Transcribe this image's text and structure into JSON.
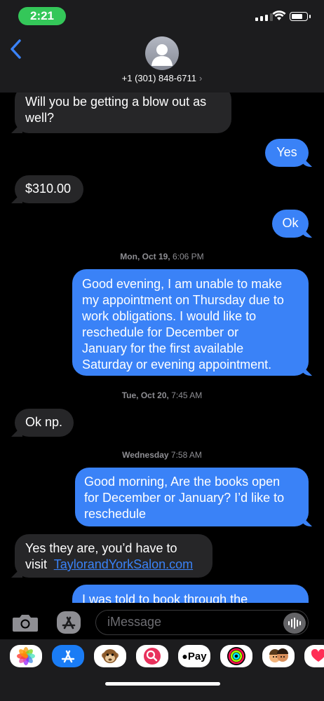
{
  "status": {
    "time": "2:21"
  },
  "header": {
    "back_label": "‹",
    "contact_number": "+1 (301) 848-6711",
    "contact_chevron": "›"
  },
  "messages": [
    {
      "dir": "in",
      "text_lines": [
        "Will you be getting a blow out as",
        "well?"
      ]
    },
    {
      "dir": "out",
      "text": "Yes"
    },
    {
      "dir": "in",
      "text": "$310.00"
    },
    {
      "dir": "out",
      "text": "Ok"
    },
    {
      "type": "timestamp",
      "day": "Mon, Oct 19,",
      "time": "6:06 PM"
    },
    {
      "dir": "out",
      "text_lines": [
        "Good evening, I am unable to make",
        "my appointment on Thursday due to",
        "work obligations. I would like to",
        "reschedule for December or",
        "January for the first available",
        "Saturday or evening appointment."
      ]
    },
    {
      "type": "timestamp",
      "day": "Tue, Oct 20,",
      "time": "7:45 AM"
    },
    {
      "dir": "in",
      "text": "Ok np."
    },
    {
      "type": "timestamp",
      "day": "Wednesday",
      "time": "7:58 AM"
    },
    {
      "dir": "out",
      "text_lines": [
        "Good morning, Are the books open",
        "for December or January? I’d like to",
        "reschedule"
      ]
    },
    {
      "dir": "in",
      "text_lines": [
        "Yes they are, you’d have to"
      ],
      "prefix": "visit",
      "link": "TaylorandYorkSalon.com"
    },
    {
      "dir": "out",
      "text": "I was told to book through the"
    }
  ],
  "input": {
    "placeholder": "iMessage"
  },
  "drawer": {
    "apps": [
      "photos-icon",
      "app-store-icon",
      "animoji-icon",
      "web-images-icon",
      "apple-pay-icon",
      "activity-icon",
      "memoji-icon",
      "heart-icon"
    ],
    "apple_pay_label": "Pay"
  },
  "colors": {
    "outgoing_bubble": "#3a82f7",
    "incoming_bubble": "#262628",
    "time_pill": "#34c759",
    "header_bg": "#1c1c1e"
  }
}
